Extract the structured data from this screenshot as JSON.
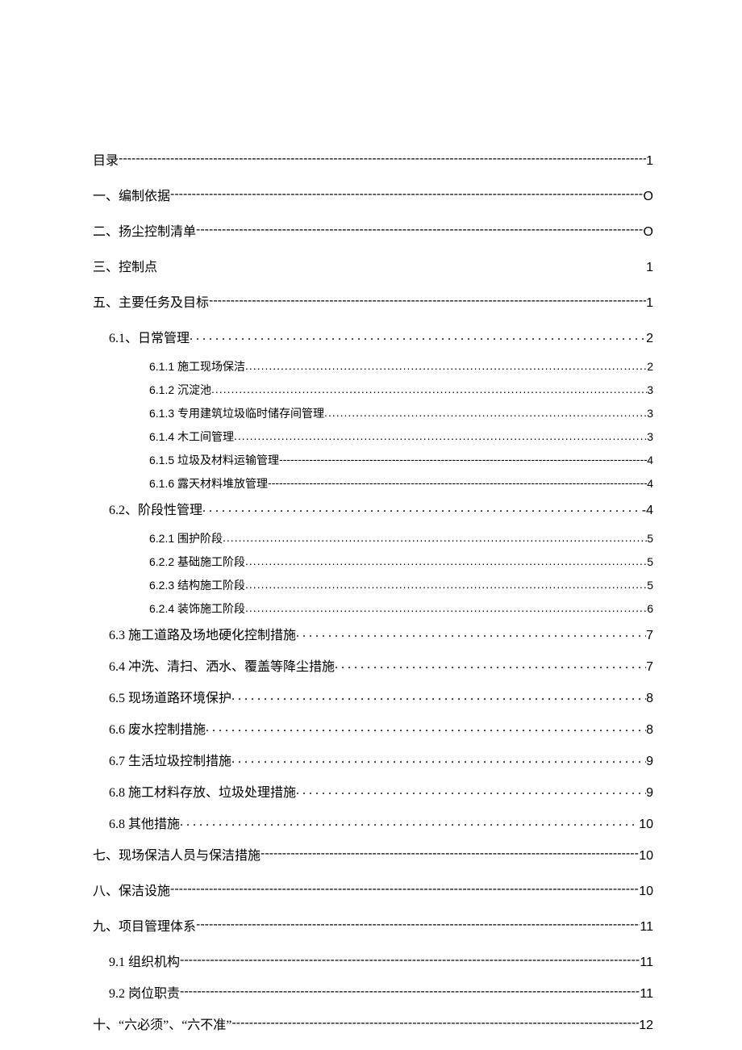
{
  "toc": [
    {
      "level": "0",
      "title": "目录",
      "leader": "dash",
      "page": "1"
    },
    {
      "level": "0",
      "title": "一、编制依据",
      "leader": "dash",
      "page": "O"
    },
    {
      "level": "0",
      "title": "二、扬尘控制清单",
      "leader": "dash",
      "page": "O"
    },
    {
      "level": "0",
      "title": "三、控制点",
      "leader": "none",
      "page": "1"
    },
    {
      "level": "0",
      "title": "五、主要任务及目标",
      "leader": "dash",
      "page": "1"
    },
    {
      "level": "1",
      "title": "6.1、日常管理",
      "leader": "dot",
      "page": "2"
    },
    {
      "level": "2",
      "title": "6.1.1 施工现场保洁",
      "leader": "tightdot",
      "page": "2"
    },
    {
      "level": "2",
      "title": "6.1.2 沉淀池",
      "leader": "tightdot",
      "page": "3"
    },
    {
      "level": "2",
      "title": "6.1.3 专用建筑垃圾临时储存间管理",
      "leader": "tightdot",
      "page": "3"
    },
    {
      "level": "2",
      "title": "6.1.4 木工间管理",
      "leader": "tightdot",
      "page": "3"
    },
    {
      "level": "2",
      "title": "6.1.5 垃圾及材料运输管理",
      "leader": "dash",
      "page": "4"
    },
    {
      "level": "2",
      "title": "6.1.6 露天材料堆放管理",
      "leader": "dash",
      "page": "4"
    },
    {
      "level": "1",
      "title": "6.2、阶段性管理",
      "leader": "dot",
      "page": "-4"
    },
    {
      "level": "2",
      "title": "6.2.1 围护阶段",
      "leader": "tightdot",
      "page": "5"
    },
    {
      "level": "2",
      "title": "6.2.2 基础施工阶段",
      "leader": "tightdot",
      "page": "5"
    },
    {
      "level": "2",
      "title": "6.2.3 结构施工阶段",
      "leader": "tightdot",
      "page": "5"
    },
    {
      "level": "2",
      "title": "6.2.4 装饰施工阶段",
      "leader": "tightdot",
      "page": "6"
    },
    {
      "level": "1b",
      "title": "6.3 施工道路及场地硬化控制措施",
      "leader": "dot",
      "page": "7"
    },
    {
      "level": "1b",
      "title": "6.4 冲洗、清扫、洒水、覆盖等降尘措施",
      "leader": "dot",
      "page": "7"
    },
    {
      "level": "1b",
      "title": "6.5 现场道路环境保护",
      "leader": "dot",
      "page": "8"
    },
    {
      "level": "1b",
      "title": "6.6 废水控制措施",
      "leader": "dot",
      "page": "8"
    },
    {
      "level": "1b",
      "title": "6.7 生活垃圾控制措施",
      "leader": "dot",
      "page": "9"
    },
    {
      "level": "1b",
      "title": "6.8 施工材料存放、垃圾处理措施",
      "leader": "dot",
      "page": "9"
    },
    {
      "level": "1b",
      "title": "6.8 其他措施",
      "leader": "dot",
      "page": "10"
    },
    {
      "level": "0",
      "title": "七、现场保洁人员与保洁措施",
      "leader": "dash",
      "page": "10"
    },
    {
      "level": "0",
      "title": "八、保洁设施",
      "leader": "dash",
      "page": "10"
    },
    {
      "level": "0",
      "title": "九、项目管理体系",
      "leader": "dash",
      "page": "11"
    },
    {
      "level": "1b",
      "title": "9.1 组织机构",
      "leader": "dash",
      "page": "11"
    },
    {
      "level": "1b",
      "title": "9.2 岗位职责",
      "leader": "dash",
      "page": "11"
    },
    {
      "level": "0",
      "title": "十、“六必须”、“六不准”",
      "leader": "dash",
      "page": "12"
    }
  ]
}
